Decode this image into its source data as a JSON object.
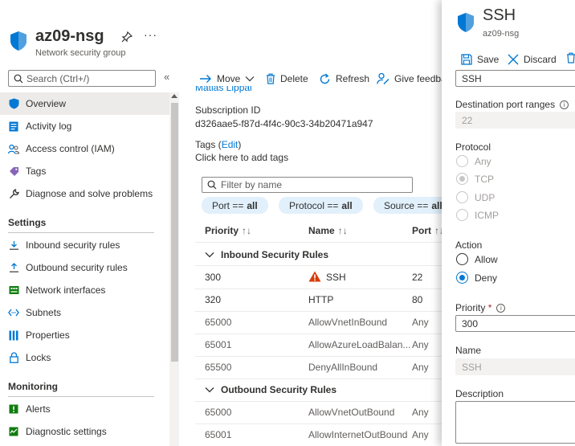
{
  "header": {
    "title": "az09-nsg",
    "subtitle": "Network security group",
    "pin_icon": "pin-icon",
    "more_label": "···"
  },
  "sidebar": {
    "search_placeholder": "Search (Ctrl+/)",
    "collapse_label": "«",
    "items": [
      {
        "label": "Overview",
        "icon": "shield-icon"
      },
      {
        "label": "Activity log",
        "icon": "log-icon"
      },
      {
        "label": "Access control (IAM)",
        "icon": "people-icon"
      },
      {
        "label": "Tags",
        "icon": "tag-icon"
      },
      {
        "label": "Diagnose and solve problems",
        "icon": "wrench-icon"
      }
    ],
    "settings_header": "Settings",
    "settings_items": [
      {
        "label": "Inbound security rules",
        "icon": "inbound-icon"
      },
      {
        "label": "Outbound security rules",
        "icon": "outbound-icon"
      },
      {
        "label": "Network interfaces",
        "icon": "nic-icon"
      },
      {
        "label": "Subnets",
        "icon": "subnet-icon"
      },
      {
        "label": "Properties",
        "icon": "properties-icon"
      },
      {
        "label": "Locks",
        "icon": "lock-icon"
      }
    ],
    "monitoring_header": "Monitoring",
    "monitoring_items": [
      {
        "label": "Alerts",
        "icon": "alerts-icon"
      },
      {
        "label": "Diagnostic settings",
        "icon": "diagnostic-icon"
      }
    ]
  },
  "toolbar": {
    "move": "Move",
    "delete": "Delete",
    "refresh": "Refresh",
    "feedback": "Give feedba"
  },
  "main": {
    "owner_partial": "Matias Lippai",
    "subscription_id_label": "Subscription ID",
    "subscription_id": "d326aae5-f87d-4f4c-90c3-34b20471a947",
    "tags_label": "Tags (",
    "tags_edit": "Edit",
    "tags_close": ")",
    "tags_add": "Click here to add tags",
    "filter_placeholder": "Filter by name",
    "pills": [
      {
        "key": "Port ==",
        "val": "all"
      },
      {
        "key": "Protocol ==",
        "val": "all"
      },
      {
        "key": "Source ==",
        "val": "all"
      }
    ],
    "columns": [
      "Priority",
      "Name",
      "Port"
    ],
    "sort_glyph": "↑↓",
    "inbound_group": "Inbound Security Rules",
    "inbound_rows": [
      {
        "priority": "300",
        "name": "SSH",
        "port": "22",
        "warn": true
      },
      {
        "priority": "320",
        "name": "HTTP",
        "port": "80",
        "warn": false
      },
      {
        "priority": "65000",
        "name": "AllowVnetInBound",
        "port": "Any",
        "warn": false
      },
      {
        "priority": "65001",
        "name": "AllowAzureLoadBalan...",
        "port": "Any",
        "warn": false
      },
      {
        "priority": "65500",
        "name": "DenyAllInBound",
        "port": "Any",
        "warn": false
      }
    ],
    "outbound_group": "Outbound Security Rules",
    "outbound_rows": [
      {
        "priority": "65000",
        "name": "AllowVnetOutBound",
        "port": "Any"
      },
      {
        "priority": "65001",
        "name": "AllowInternetOutBound",
        "port": "Any"
      }
    ]
  },
  "panel": {
    "title": "SSH",
    "subtitle": "az09-nsg",
    "save": "Save",
    "discard": "Discard",
    "top_value": "SSH",
    "dest_port_label": "Destination port ranges",
    "dest_port_value": "22",
    "protocol_label": "Protocol",
    "protocols": [
      "Any",
      "TCP",
      "UDP",
      "ICMP"
    ],
    "protocol_selected": "TCP",
    "action_label": "Action",
    "actions": [
      "Allow",
      "Deny"
    ],
    "action_selected": "Deny",
    "priority_label": "Priority",
    "priority_required": "*",
    "priority_value": "300",
    "name_label": "Name",
    "name_value": "SSH",
    "description_label": "Description",
    "info_glyph": "i"
  },
  "colors": {
    "accent": "#0078d4",
    "warning": "#d83b01",
    "pill_bg": "#e1f0fb",
    "required": "#a4262c"
  }
}
